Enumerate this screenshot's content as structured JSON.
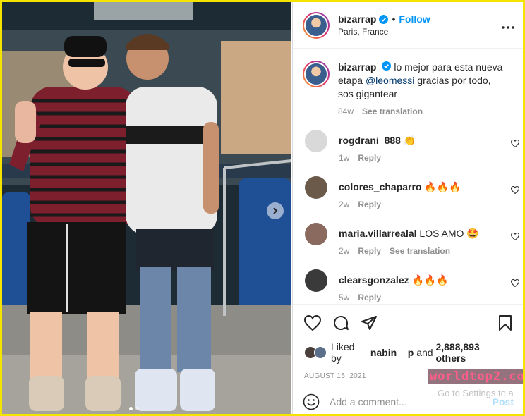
{
  "post": {
    "username": "bizarrap",
    "follow_label": "Follow",
    "separator": "•",
    "location": "Paris, France",
    "caption_prefix": "lo mejor para esta nueva etapa",
    "caption_mention": "@leomessi",
    "caption_suffix": "gracias por todo, sos gigantear",
    "caption_age": "84w",
    "see_translation": "See translation",
    "slide_count": 2,
    "active_slide": 1
  },
  "comments": [
    {
      "username": "rogdrani_888",
      "text": "👏",
      "age": "1w",
      "reply": "Reply",
      "avatar_color": "#d9d9d9"
    },
    {
      "username": "colores_chaparro",
      "text": "🔥🔥🔥",
      "age": "2w",
      "reply": "Reply",
      "avatar_color": "#6b5a4a"
    },
    {
      "username": "maria.villarrealal",
      "text": "LOS AMO 🤩",
      "age": "2w",
      "reply": "Reply",
      "translation": "See translation",
      "avatar_color": "#8a6a5e"
    },
    {
      "username": "clearsgonzalez",
      "text": "🔥🔥🔥",
      "age": "5w",
      "reply": "Reply",
      "avatar_color": "#3a3a3a"
    }
  ],
  "likes": {
    "prefix": "Liked by",
    "user": "nabin__p",
    "joiner": "and",
    "count": "2,888,893 others"
  },
  "date": "AUGUST 15, 2021",
  "add_comment": {
    "placeholder": "Add a comment...",
    "post_label": "Post"
  },
  "overlay": {
    "watermark": "worldtop2.com",
    "activation_text": "Go to Settings to a"
  },
  "colors": {
    "accent": "#0095f6",
    "frame": "#f5e400",
    "post_disabled": "#b2dffc"
  }
}
